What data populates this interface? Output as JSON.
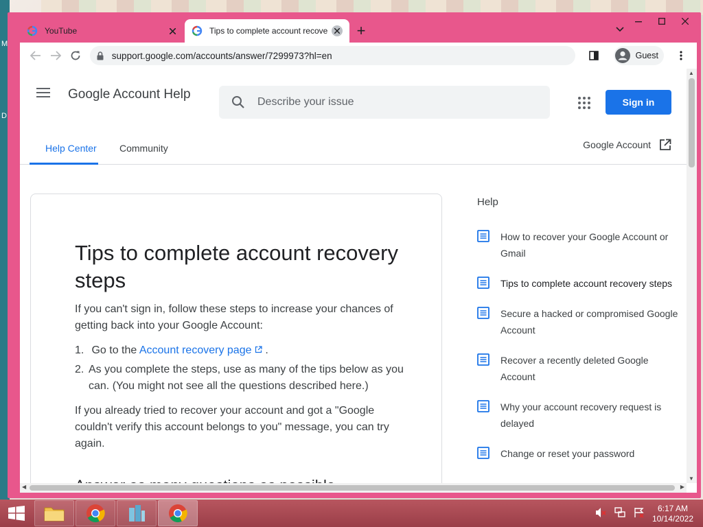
{
  "desktop": {
    "labels": [
      "M",
      "D"
    ]
  },
  "browser": {
    "tabs": [
      {
        "title": "YouTube",
        "active": false
      },
      {
        "title": "Tips to complete account recove",
        "active": true
      }
    ],
    "new_tab_label": "+",
    "url": "support.google.com/accounts/answer/7299973?hl=en",
    "profile": "Guest"
  },
  "header": {
    "product_name": "Google Account Help",
    "search_placeholder": "Describe your issue",
    "signin_label": "Sign in"
  },
  "subnav": {
    "items": [
      "Help Center",
      "Community"
    ],
    "account_link": "Google Account"
  },
  "article": {
    "title": "Tips to complete account recovery steps",
    "intro": "If you can't sign in, follow these steps to increase your chances of getting back into your Google Account:",
    "steps": [
      {
        "num": "1.",
        "before": "Go to the ",
        "link": "Account recovery page",
        "after": " ."
      },
      {
        "num": "2.",
        "text": "As you complete the steps, use as many of the tips below as you can. (You might not see all the questions described here.)"
      }
    ],
    "retry": "If you already tried to recover your account and got a \"Google couldn't verify this account belongs to you\" message, you can try again.",
    "subhead": "Answer as many questions as possible"
  },
  "help_panel": {
    "title": "Help",
    "items": [
      "How to recover your Google Account or Gmail",
      "Tips to complete account recovery steps",
      "Secure a hacked or compromised Google Account",
      "Recover a recently deleted Google Account",
      "Why your account recovery request is delayed",
      "Change or reset your password"
    ]
  },
  "taskbar": {
    "time": "6:17 AM",
    "date": "10/14/2022"
  },
  "colors": {
    "window_frame": "#e8578c",
    "accent_blue": "#1a73e8",
    "taskbar": "#a8464f"
  }
}
